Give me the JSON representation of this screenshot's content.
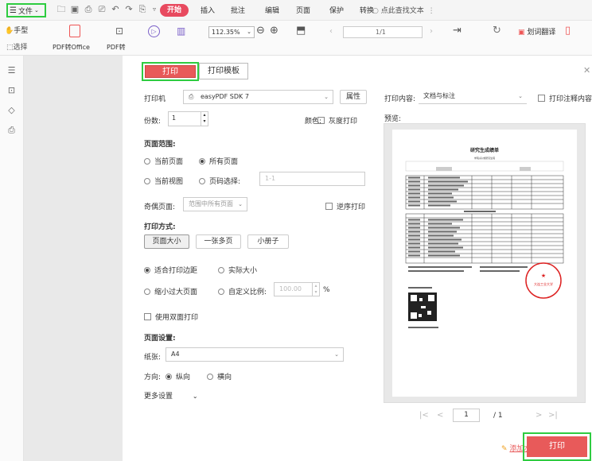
{
  "menubar": {
    "file": "文件",
    "start": "开始",
    "insert": "插入",
    "annotate": "批注",
    "edit": "编辑",
    "page": "页面",
    "protect": "保护",
    "convert": "转换",
    "search": "点此查找文本"
  },
  "toolbar": {
    "hand": "手型",
    "select": "选择",
    "pdf_to_office": "PDF转Office",
    "pdf_other": "PDF转",
    "zoom": "112.35%",
    "page_indicator": "1/1",
    "translate": "划词翻译"
  },
  "dialog": {
    "tab_print": "打印",
    "tab_template": "打印模板",
    "printer_label": "打印机",
    "printer_value": "easyPDF SDK 7",
    "properties": "属性",
    "copies_label": "份数:",
    "copies_value": "1",
    "color_label": "颜色:",
    "grayscale": "灰度打印",
    "content_label": "打印内容:",
    "content_value": "文档与标注",
    "print_comments": "打印注释内容",
    "preview_label": "预览:",
    "range_title": "页面范围:",
    "current_page": "当前页面",
    "all_pages": "所有页面",
    "current_view": "当前视图",
    "page_select": "页码选择:",
    "page_select_placeholder": "1-1",
    "odd_even_label": "奇偶页面:",
    "odd_even_value": "范围中所有页面",
    "reverse": "逆序打印",
    "mode_title": "打印方式:",
    "mode_page_size": "页面大小",
    "mode_multi": "一张多页",
    "mode_booklet": "小册子",
    "fit_margin": "适合打印边距",
    "actual_size": "实际大小",
    "shrink": "缩小过大页面",
    "custom_scale": "自定义比例:",
    "custom_scale_value": "100.00",
    "percent": "%",
    "duplex": "使用双面打印",
    "page_setup_title": "页面设置:",
    "paper_label": "纸张:",
    "paper_value": "A4",
    "orientation_label": "方向:",
    "portrait": "纵向",
    "landscape": "横向",
    "more_settings": "更多设置",
    "preview_page": "1",
    "preview_total": "/ 1",
    "add_watermark": "添加水印",
    "print_button": "打印"
  },
  "preview_doc": {
    "title": "研究生成绩单",
    "subtitle": "学院(系)或研究生院",
    "stamp": "大连工业大学"
  },
  "colors": {
    "accent": "#e85a5a",
    "highlight": "#2ecc40"
  }
}
